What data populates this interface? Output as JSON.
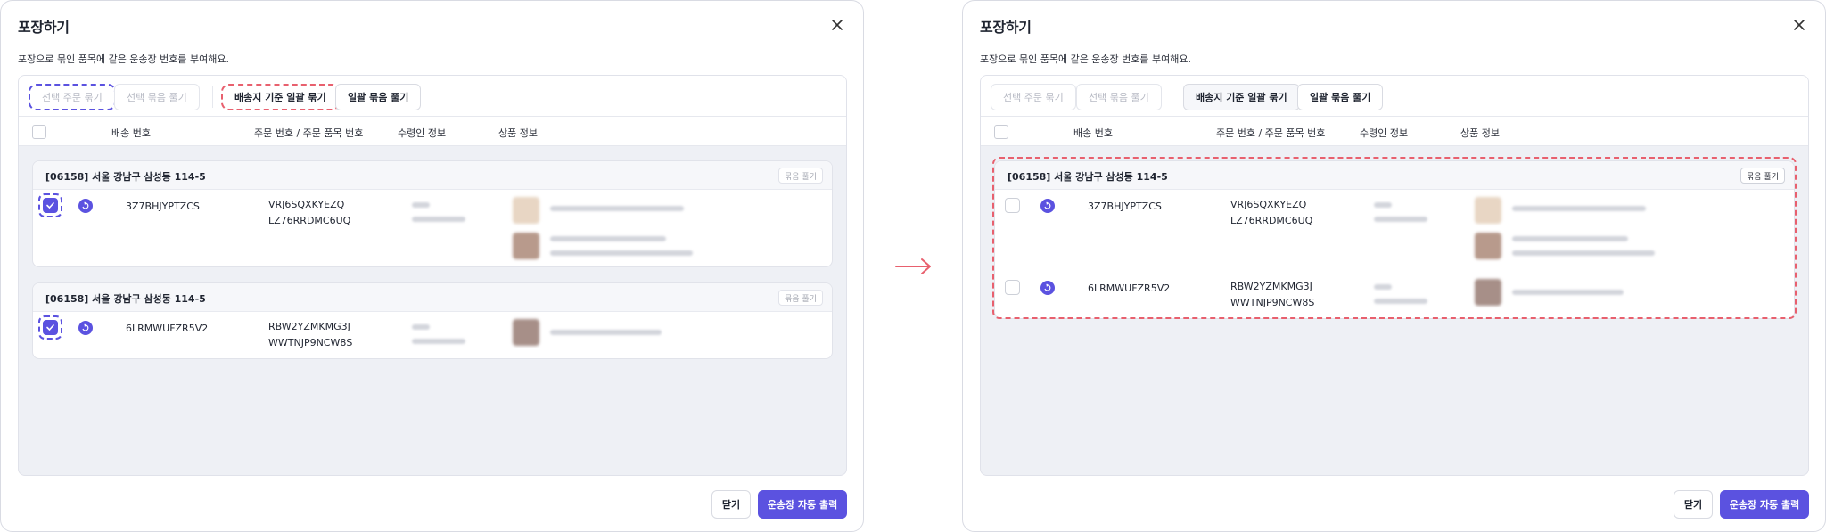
{
  "left": {
    "title": "포장하기",
    "description": "포장으로 묶인 품목에 같은 운송장 번호를 부여해요.",
    "toolbar": {
      "bundle_selected_orders": "선택 주문 묶기",
      "unbundle_selected": "선택 묶음 풀기",
      "bundle_by_destination": "배송지 기준 일괄 묶기",
      "unbundle_all": "일괄 묶음 풀기"
    },
    "columns": {
      "shipping_no": "배송 번호",
      "order_no": "주문 번호 / 주문 품목 번호",
      "recipient": "수령인 정보",
      "product": "상품 정보"
    },
    "groups": [
      {
        "address": "[06158] 서울 강남구 삼성동 114-5",
        "unbundle_label": "묶음 풀기",
        "rows": [
          {
            "shipping_no": "3Z7BHJYPTZCS",
            "order_no": "VRJ6SQXKYEZQ",
            "item_no": "LZ76RRDMC6UQ"
          }
        ]
      },
      {
        "address": "[06158] 서울 강남구 삼성동 114-5",
        "unbundle_label": "묶음 풀기",
        "rows": [
          {
            "shipping_no": "6LRMWUFZR5V2",
            "order_no": "RBW2YZMKMG3J",
            "item_no": "WWTNJP9NCW8S"
          }
        ]
      }
    ],
    "footer": {
      "close": "닫기",
      "print": "운송장 자동 출력"
    }
  },
  "right": {
    "title": "포장하기",
    "description": "포장으로 묶인 품목에 같은 운송장 번호를 부여해요.",
    "toolbar": {
      "bundle_selected_orders": "선택 주문 묶기",
      "unbundle_selected": "선택 묶음 풀기",
      "bundle_by_destination": "배송지 기준 일괄 묶기",
      "unbundle_all": "일괄 묶음 풀기"
    },
    "columns": {
      "shipping_no": "배송 번호",
      "order_no": "주문 번호 / 주문 품목 번호",
      "recipient": "수령인 정보",
      "product": "상품 정보"
    },
    "group": {
      "address": "[06158] 서울 강남구 삼성동 114-5",
      "unbundle_label": "묶음 풀기",
      "rows": [
        {
          "shipping_no": "3Z7BHJYPTZCS",
          "order_no": "VRJ6SQXKYEZQ",
          "item_no": "LZ76RRDMC6UQ"
        },
        {
          "shipping_no": "6LRMWUFZR5V2",
          "order_no": "RBW2YZMKMG3J",
          "item_no": "WWTNJP9NCW8S"
        }
      ]
    },
    "footer": {
      "close": "닫기",
      "print": "운송장 자동 출력"
    }
  },
  "arrow_icon": "right-arrow-icon",
  "colors": {
    "accent": "#5b52e0",
    "highlight_red": "#e8606e"
  }
}
